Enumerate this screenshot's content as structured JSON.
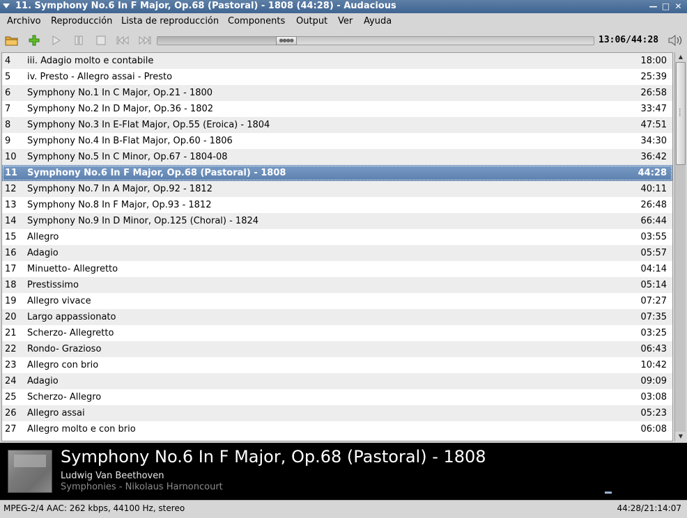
{
  "window": {
    "title": "11. Symphony No.6 In F Major, Op.68 (Pastoral) - 1808 (44:28) - Audacious"
  },
  "menu": {
    "items": [
      "Archivo",
      "Reproducción",
      "Lista de reproducción",
      "Components",
      "Output",
      "Ver",
      "Ayuda"
    ]
  },
  "toolbar": {
    "time": "13:06/44:28",
    "seek_progress": 0.295
  },
  "playlist": {
    "selected_index": 7,
    "rows": [
      {
        "num": "4",
        "title": "iii. Adagio molto e contabile",
        "duration": "18:00"
      },
      {
        "num": "5",
        "title": "iv. Presto - Allegro assai - Presto",
        "duration": "25:39"
      },
      {
        "num": "6",
        "title": "Symphony No.1 In C Major, Op.21 - 1800",
        "duration": "26:58"
      },
      {
        "num": "7",
        "title": "Symphony No.2 In D Major, Op.36 - 1802",
        "duration": "33:47"
      },
      {
        "num": "8",
        "title": "Symphony No.3 In E-Flat Major, Op.55 (Eroica) - 1804",
        "duration": "47:51"
      },
      {
        "num": "9",
        "title": "Symphony No.4 In B-Flat Major, Op.60 - 1806",
        "duration": "34:30"
      },
      {
        "num": "10",
        "title": "Symphony No.5 In C Minor, Op.67 - 1804-08",
        "duration": "36:42"
      },
      {
        "num": "11",
        "title": "Symphony No.6 In F Major, Op.68 (Pastoral) - 1808",
        "duration": "44:28"
      },
      {
        "num": "12",
        "title": "Symphony No.7 In A Major, Op.92 - 1812",
        "duration": "40:11"
      },
      {
        "num": "13",
        "title": "Symphony No.8 In F Major, Op.93 - 1812",
        "duration": "26:48"
      },
      {
        "num": "14",
        "title": "Symphony No.9 In D Minor, Op.125 (Choral) - 1824",
        "duration": "66:44"
      },
      {
        "num": "15",
        "title": "Allegro",
        "duration": "03:55"
      },
      {
        "num": "16",
        "title": "Adagio",
        "duration": "05:57"
      },
      {
        "num": "17",
        "title": "Minuetto- Allegretto",
        "duration": "04:14"
      },
      {
        "num": "18",
        "title": "Prestissimo",
        "duration": "05:14"
      },
      {
        "num": "19",
        "title": "Allegro vivace",
        "duration": "07:27"
      },
      {
        "num": "20",
        "title": "Largo appassionato",
        "duration": "07:35"
      },
      {
        "num": "21",
        "title": "Scherzo- Allegretto",
        "duration": "03:25"
      },
      {
        "num": "22",
        "title": "Rondo- Grazioso",
        "duration": "06:43"
      },
      {
        "num": "23",
        "title": "Allegro con brio",
        "duration": "10:42"
      },
      {
        "num": "24",
        "title": "Adagio",
        "duration": "09:09"
      },
      {
        "num": "25",
        "title": "Scherzo- Allegro",
        "duration": "03:08"
      },
      {
        "num": "26",
        "title": "Allegro assai",
        "duration": "05:23"
      },
      {
        "num": "27",
        "title": "Allegro molto e con brio",
        "duration": "06:08"
      }
    ]
  },
  "now_playing": {
    "title": "Symphony No.6 In F Major, Op.68 (Pastoral) - 1808",
    "artist": "Ludwig Van Beethoven",
    "album": "Symphonies - Nikolaus Harnoncourt"
  },
  "status": {
    "format": "MPEG-2/4 AAC: 262 kbps, 44100 Hz, stereo",
    "time": "44:28/21:14:07"
  },
  "colors": {
    "selection": "#6688b6",
    "titlebar": "#4a6e99",
    "info_bg": "#000000"
  }
}
